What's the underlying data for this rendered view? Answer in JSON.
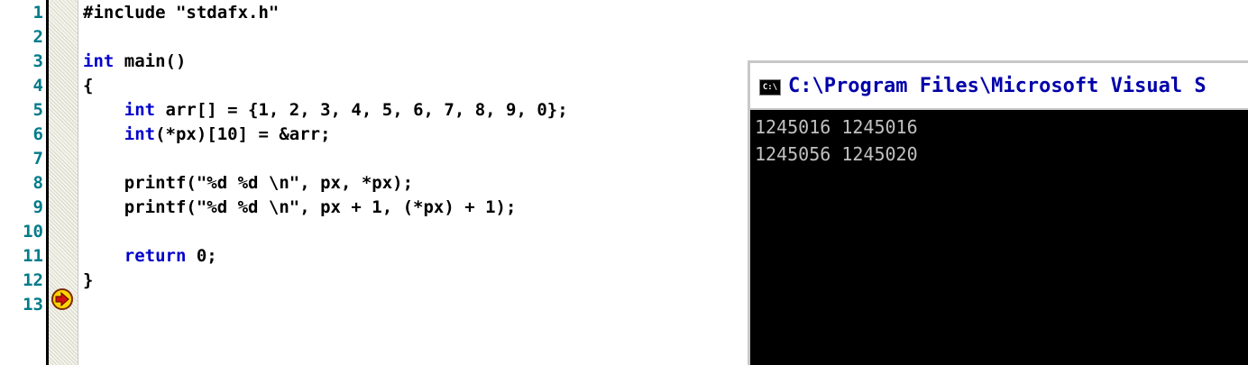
{
  "editor": {
    "line_numbers": [
      "1",
      "2",
      "3",
      "4",
      "5",
      "6",
      "7",
      "8",
      "9",
      "10",
      "11",
      "12",
      "13"
    ],
    "current_line_marker": "current-statement-arrow",
    "lines": [
      [
        {
          "t": "#include \"stdafx.h\"",
          "k": false
        }
      ],
      [],
      [
        {
          "t": "int",
          "k": true
        },
        {
          "t": " main()",
          "k": false
        }
      ],
      [
        {
          "t": "{",
          "k": false
        }
      ],
      [
        {
          "t": "    ",
          "k": false
        },
        {
          "t": "int",
          "k": true
        },
        {
          "t": " arr[] = {1, 2, 3, 4, 5, 6, 7, 8, 9, 0};",
          "k": false
        }
      ],
      [
        {
          "t": "    ",
          "k": false
        },
        {
          "t": "int",
          "k": true
        },
        {
          "t": "(*px)[10] = &arr;",
          "k": false
        }
      ],
      [],
      [
        {
          "t": "    printf(\"%d %d \\n\", px, *px);",
          "k": false
        }
      ],
      [
        {
          "t": "    printf(\"%d %d \\n\", px + 1, (*px) + 1);",
          "k": false
        }
      ],
      [],
      [
        {
          "t": "    ",
          "k": false
        },
        {
          "t": "return",
          "k": true
        },
        {
          "t": " 0;",
          "k": false
        }
      ],
      [
        {
          "t": "}",
          "k": false
        }
      ],
      []
    ]
  },
  "console": {
    "icon_text": "C:\\",
    "title": "C:\\Program Files\\Microsoft Visual S",
    "output_lines": [
      "1245016 1245016",
      "1245056 1245020"
    ]
  },
  "colors": {
    "line_number": "#007b8a",
    "keyword": "#0000cc",
    "console_bg": "#000000",
    "console_text": "#c0c0c0",
    "console_title": "#0000aa",
    "marker": "#ffd400"
  }
}
